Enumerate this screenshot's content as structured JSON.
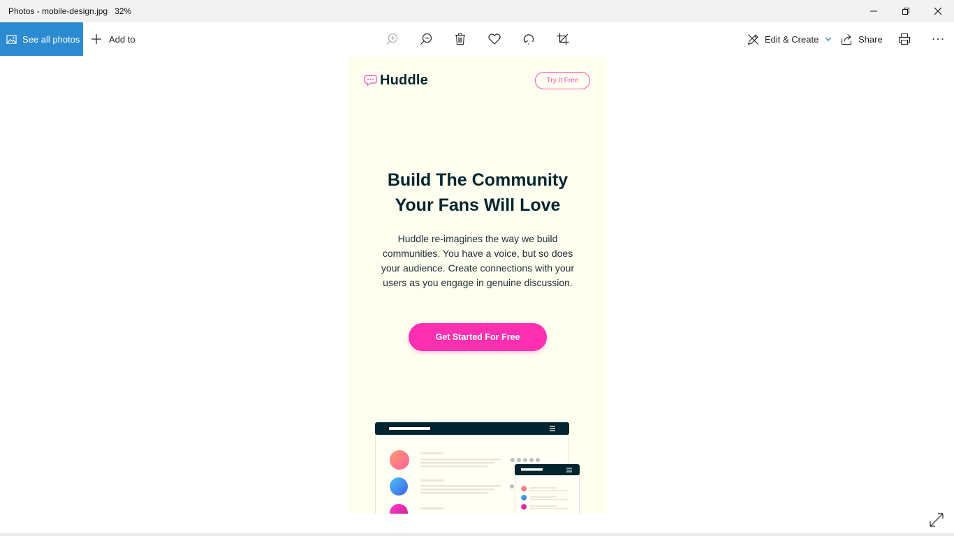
{
  "window": {
    "title": "Photos - mobile-design.jpg",
    "zoom": "32%"
  },
  "toolbar": {
    "see_all_label": "See all photos",
    "add_to_label": "Add to",
    "edit_create_label": "Edit & Create",
    "share_label": "Share",
    "icons": [
      "zoom-in-icon",
      "zoom-out-icon",
      "delete-icon",
      "favorite-icon",
      "rotate-icon",
      "crop-icon",
      "print-icon",
      "more-icon"
    ]
  },
  "image": {
    "logo_text": "Huddle",
    "try_button": "Try It Free",
    "headline_line1": "Build The Community",
    "headline_line2": "Your Fans Will Love",
    "description": "Huddle re-imagines the way we build communities. You have a voice, but so does your audience. Create connections with your users as you engage in genuine discussion.",
    "cta_button": "Get Started For Free"
  },
  "colors": {
    "accent": "#2b8ad0",
    "brand_pink": "#ff2fb1",
    "brand_dark": "#00252e",
    "image_bg": "#fffff0"
  }
}
